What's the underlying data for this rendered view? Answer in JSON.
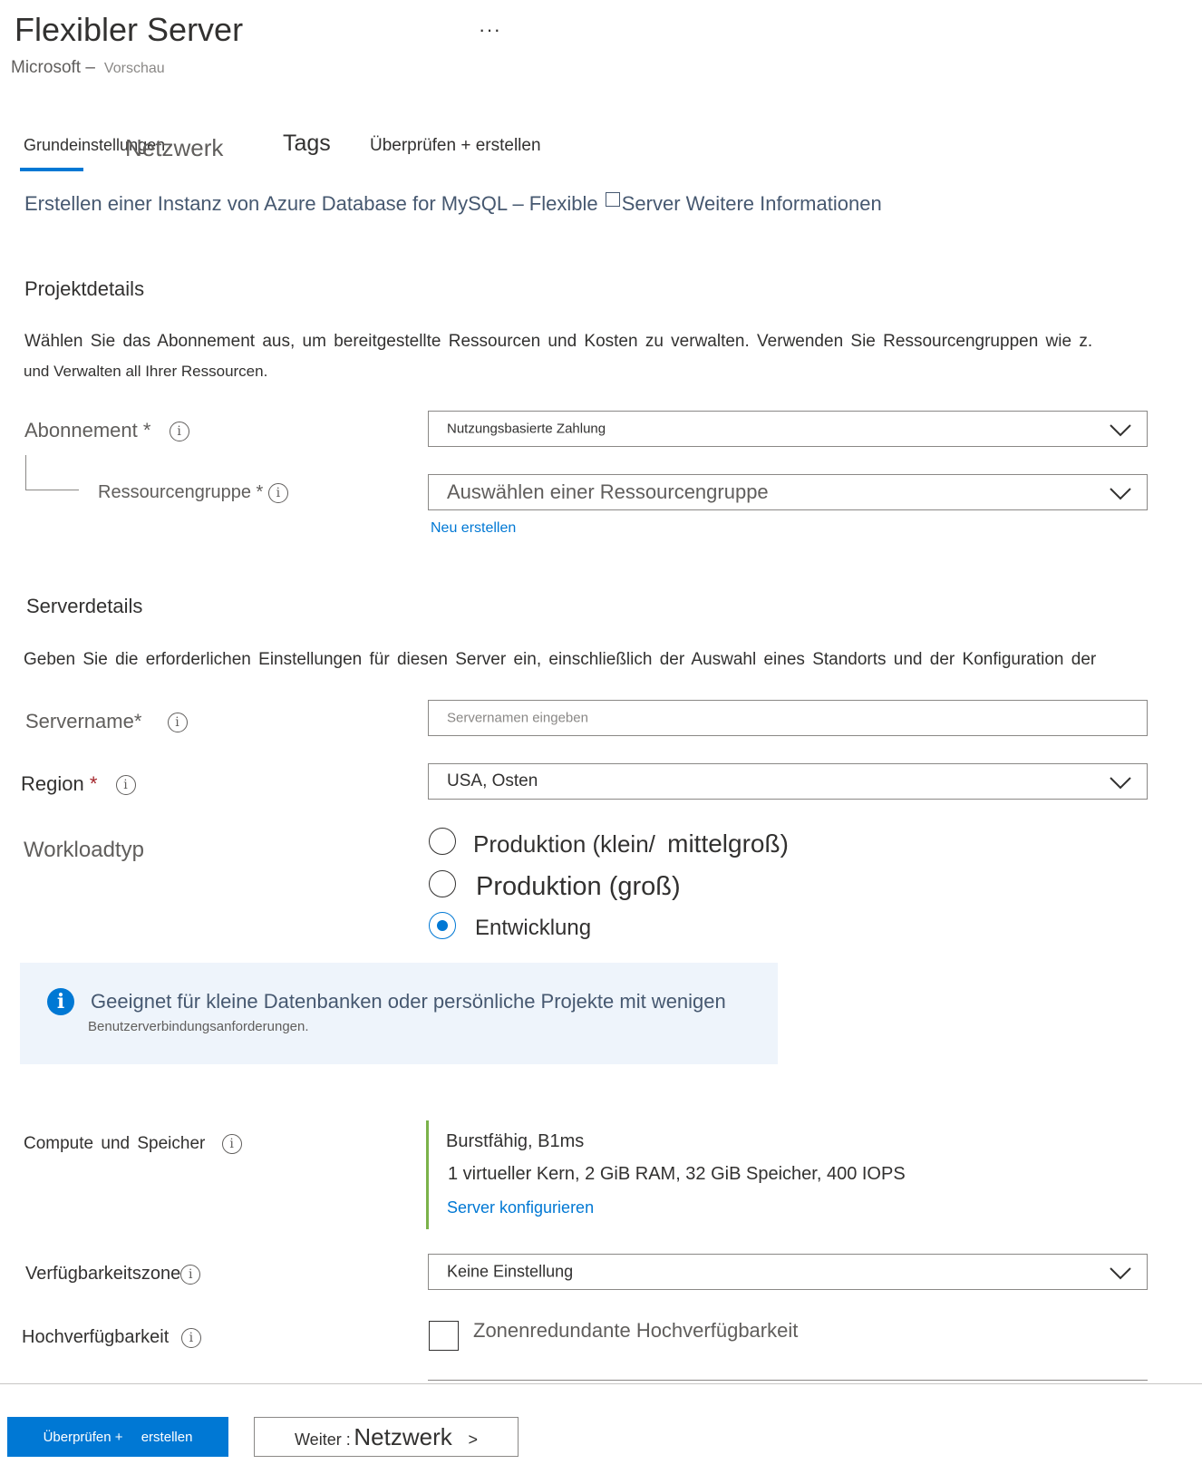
{
  "header": {
    "title": "Flexibler Server",
    "more": "···",
    "publisher": "Microsoft –",
    "preview": "Vorschau"
  },
  "tabs": [
    {
      "label": "Grundeinstellungen"
    },
    {
      "label": "Netzwerk"
    },
    {
      "label": "Tags"
    },
    {
      "label": "Überprüfen + erstellen"
    }
  ],
  "intro": {
    "text_before": "Erstellen einer Instanz von Azure Database for MySQL – Flexible ",
    "text_after": "Server Weitere Informationen"
  },
  "project": {
    "title": "Projektdetails",
    "desc_line1": "Wählen Sie das Abonnement aus, um bereitgestellte Ressourcen und Kosten zu verwalten. Verwenden Sie Ressourcengruppen wie z.",
    "desc_line2": "und Verwalten all Ihrer Ressourcen.",
    "subscription_label": "Abonnement *",
    "subscription_value": "Nutzungsbasierte Zahlung",
    "resource_group_label": "Ressourcengruppe *",
    "resource_group_placeholder": "Auswählen einer Ressourcengruppe",
    "create_new": "Neu erstellen"
  },
  "server": {
    "title": "Serverdetails",
    "desc": "Geben Sie die erforderlichen Einstellungen für diesen Server ein, einschließlich der Auswahl eines Standorts und der Konfiguration der",
    "servername_label": "Servername*",
    "servername_placeholder": "Servernamen eingeben",
    "region_label": "Region",
    "region_required": "*",
    "region_value": "USA, Osten",
    "workload_label": "Workloadtyp",
    "workload_options": [
      {
        "label_a": "Produktion (klein/",
        "label_b": "mittelgroß)",
        "checked": false
      },
      {
        "label": "Produktion (groß)",
        "checked": false
      },
      {
        "label": "Entwicklung",
        "checked": true
      }
    ],
    "info_main": "Geeignet für kleine Datenbanken oder persönliche Projekte mit wenigen",
    "info_sub": "Benutzerverbindungsanforderungen.",
    "compute_label": "Compute und Speicher",
    "compute_tier": "Burstfähig, B1ms",
    "compute_specs": "1 virtueller Kern, 2 GiB RAM, 32 GiB Speicher, 400 IOPS",
    "compute_link": "Server konfigurieren",
    "availability_zone_label": "Verfügbarkeitszone",
    "availability_zone_value": "Keine Einstellung",
    "ha_label": "Hochverfügbarkeit",
    "ha_checkbox_label": "Zonenredundante Hochverfügbarkeit",
    "ha_checked": false
  },
  "footer": {
    "review_a": "Überprüfen +",
    "review_b": "erstellen",
    "next_a": "Weiter :",
    "next_b": "Netzwerk",
    "next_c": ">"
  },
  "colors": {
    "accent": "#0078d4",
    "compute_bar": "#7bb24a",
    "required": "#a4262c",
    "info_bg": "#eef4fb"
  }
}
